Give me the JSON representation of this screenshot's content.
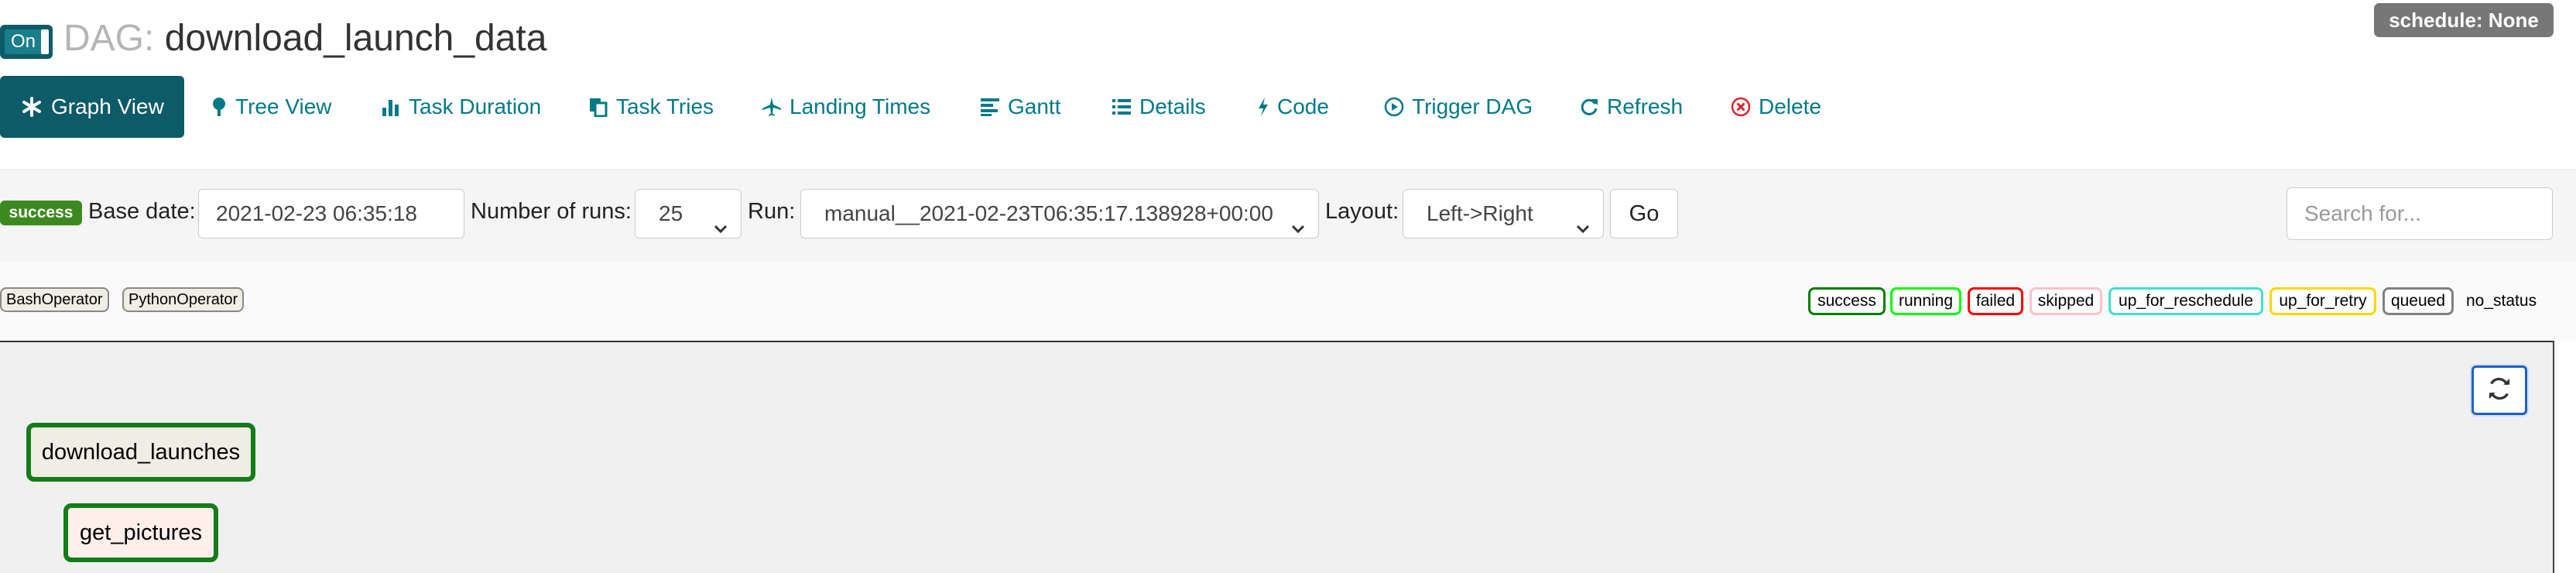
{
  "header": {
    "toggle_label": "On",
    "title_prefix": "DAG:",
    "dag_id": "download_launch_data",
    "schedule": "schedule: None"
  },
  "nav": {
    "graph_view": "Graph View",
    "tree_view": "Tree View",
    "task_duration": "Task Duration",
    "task_tries": "Task Tries",
    "landing_times": "Landing Times",
    "gantt": "Gantt",
    "details": "Details",
    "code": "Code",
    "trigger_dag": "Trigger DAG",
    "refresh": "Refresh",
    "delete": "Delete"
  },
  "form": {
    "state_badge": "success",
    "base_date_label": "Base date:",
    "base_date_value": "2021-02-23 06:35:18",
    "num_runs_label": "Number of runs:",
    "num_runs_value": "25",
    "run_label": "Run:",
    "run_value": "manual__2021-02-23T06:35:17.138928+00:00",
    "layout_label": "Layout:",
    "layout_value": "Left->Right",
    "go_label": "Go",
    "search_placeholder": "Search for..."
  },
  "operators": [
    "BashOperator",
    "PythonOperator"
  ],
  "states": [
    {
      "label": "success",
      "color": "#008000"
    },
    {
      "label": "running",
      "color": "#00ff00"
    },
    {
      "label": "failed",
      "color": "#ff0000"
    },
    {
      "label": "skipped",
      "color": "#ffc0cb"
    },
    {
      "label": "up_for_reschedule",
      "color": "#40e0d0"
    },
    {
      "label": "up_for_retry",
      "color": "#ffd700"
    },
    {
      "label": "queued",
      "color": "#808080"
    }
  ],
  "no_status": "no_status",
  "graph": {
    "nodes": [
      {
        "task_id": "download_launches",
        "operator": "BashOperator",
        "state": "success",
        "fill": "#f0ede4"
      },
      {
        "task_id": "get_pictures",
        "operator": "PythonOperator",
        "state": "success",
        "fill": "#ffefeb"
      }
    ]
  },
  "colors": {
    "primary": "#0d5b68",
    "link": "#007a87",
    "success": "#3c8a1e",
    "node_border": "#137d1a",
    "delete": "#d9232e"
  }
}
